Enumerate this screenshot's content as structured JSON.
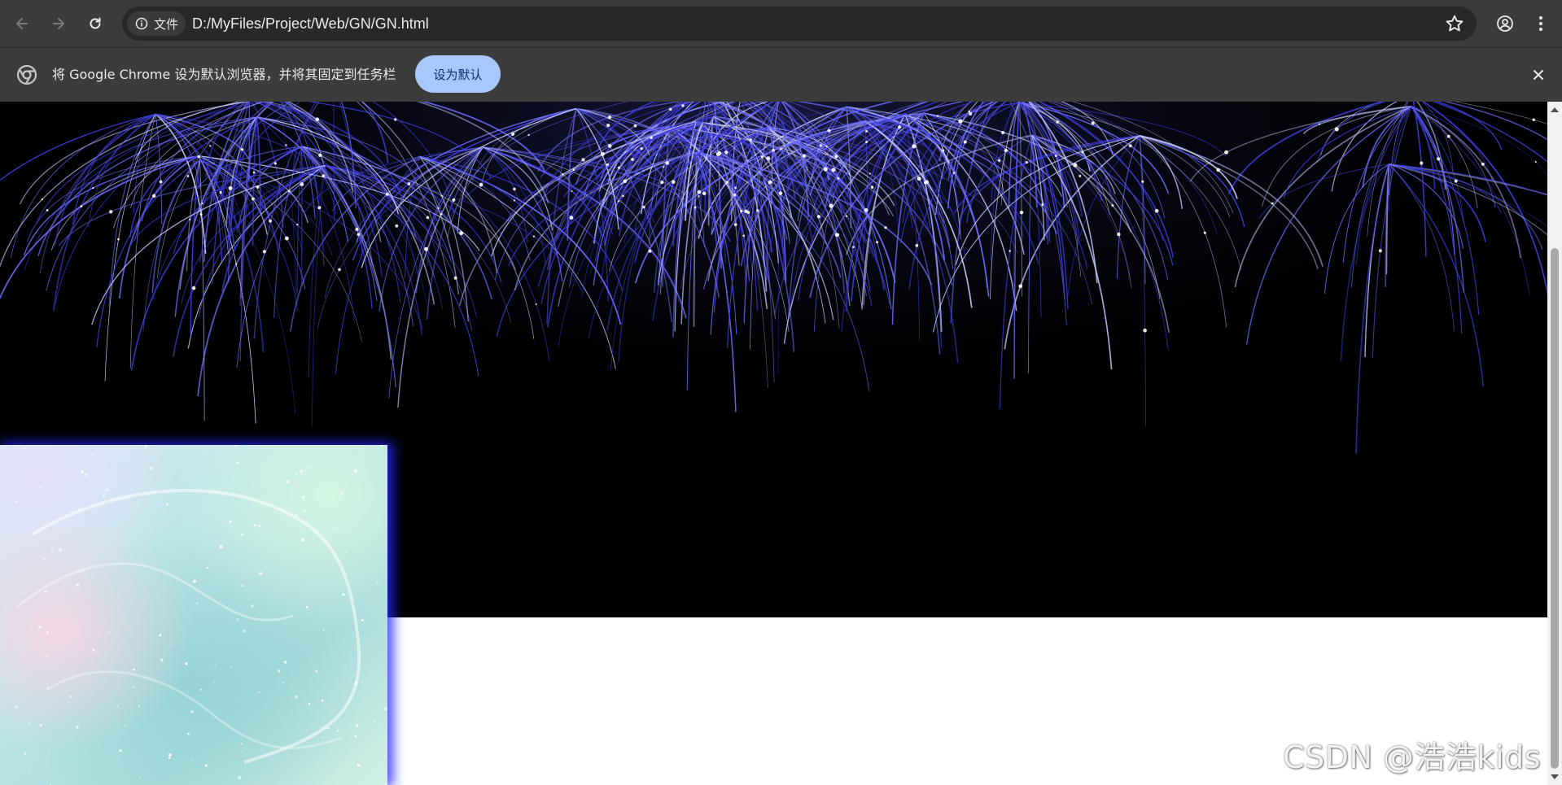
{
  "browser": {
    "site_info_label": "文件",
    "url": "D:/MyFiles/Project/Web/GN/GN.html",
    "icons": {
      "back": "back-arrow-icon",
      "forward": "forward-arrow-icon",
      "reload": "reload-icon",
      "site_info": "info-icon",
      "bookmark": "star-icon",
      "profile": "profile-icon",
      "menu": "kebab-menu-icon"
    }
  },
  "infobar": {
    "message": "将 Google Chrome 设为默认浏览器，并将其固定到任务栏",
    "default_button_label": "设为默认",
    "button_color": "#a8c7fa"
  },
  "page": {
    "watermark": "CSDN @浩浩kids",
    "banner_color": "#000000",
    "firework_color": "#5a5aff"
  }
}
